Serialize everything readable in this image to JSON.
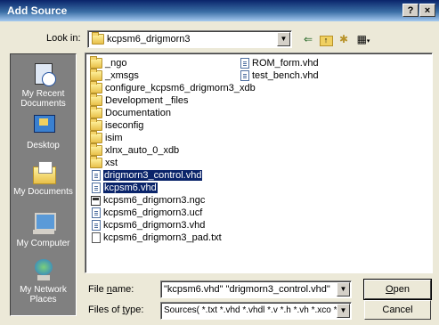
{
  "window": {
    "title": "Add Source",
    "help_label": "?",
    "close_label": "×"
  },
  "lookin": {
    "label": "Look in:",
    "value": "kcpsm6_drigmorn3"
  },
  "toolbar": {
    "back": "⇐",
    "up": "↑",
    "new_folder": "✱",
    "views": "▦"
  },
  "places": [
    {
      "label": "My Recent Documents",
      "icon": "recent-documents-icon"
    },
    {
      "label": "Desktop",
      "icon": "desktop-icon"
    },
    {
      "label": "My Documents",
      "icon": "my-documents-icon"
    },
    {
      "label": "My Computer",
      "icon": "my-computer-icon"
    },
    {
      "label": "My Network Places",
      "icon": "network-places-icon"
    }
  ],
  "files": {
    "col1": [
      {
        "name": "_ngo",
        "type": "folder"
      },
      {
        "name": "_xmsgs",
        "type": "folder"
      },
      {
        "name": "configure_kcpsm6_drigmorn3_xdb",
        "type": "folder"
      },
      {
        "name": "Development _files",
        "type": "folder"
      },
      {
        "name": "Documentation",
        "type": "folder"
      },
      {
        "name": "iseconfig",
        "type": "folder"
      },
      {
        "name": "isim",
        "type": "folder"
      },
      {
        "name": "xlnx_auto_0_xdb",
        "type": "folder"
      },
      {
        "name": "xst",
        "type": "folder"
      },
      {
        "name": "drigmorn3_control.vhd",
        "type": "vhd",
        "selected": true
      },
      {
        "name": "kcpsm6.vhd",
        "type": "vhd",
        "selected": true
      },
      {
        "name": "kcpsm6_drigmorn3.ngc",
        "type": "ngc"
      },
      {
        "name": "kcpsm6_drigmorn3.ucf",
        "type": "vhd"
      },
      {
        "name": "kcpsm6_drigmorn3.vhd",
        "type": "vhd"
      },
      {
        "name": "kcpsm6_drigmorn3_pad.txt",
        "type": "txt"
      }
    ],
    "col2": [
      {
        "name": "ROM_form.vhd",
        "type": "vhd"
      },
      {
        "name": "test_bench.vhd",
        "type": "vhd"
      }
    ]
  },
  "filename": {
    "label_pre": "File ",
    "label_u": "n",
    "label_post": "ame:",
    "value": "\"kcpsm6.vhd\" \"drigmorn3_control.vhd\""
  },
  "filetype": {
    "label_pre": "Files of ",
    "label_u": "t",
    "label_post": "ype:",
    "value": "Sources( *.txt *.vhd *.vhdl *.v *.h *.vh *.xco *.sc"
  },
  "buttons": {
    "open_u": "O",
    "open_rest": "pen",
    "cancel": "Cancel"
  }
}
